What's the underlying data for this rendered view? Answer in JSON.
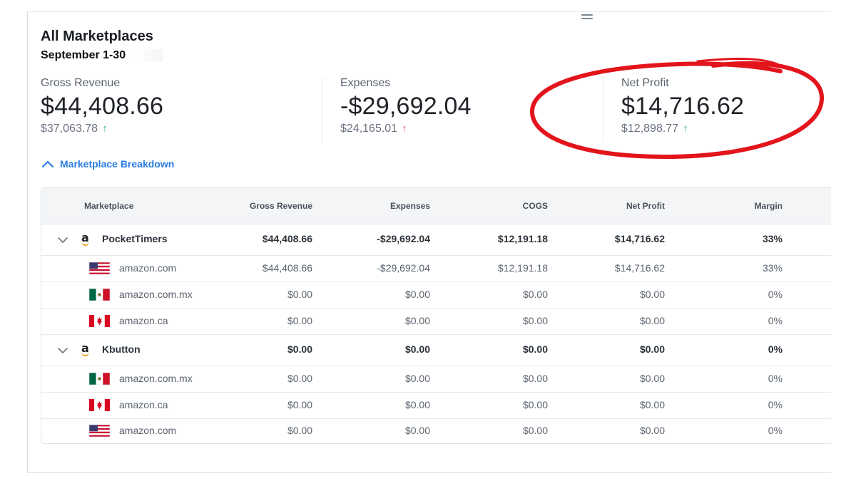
{
  "header": {
    "title": "All Marketplaces",
    "date_range": "September 1-30"
  },
  "summary": {
    "gross_revenue": {
      "label": "Gross Revenue",
      "value": "$44,408.66",
      "previous": "$37,063.78",
      "trend": "up",
      "trend_color": "#2fb67c"
    },
    "expenses": {
      "label": "Expenses",
      "value": "-$29,692.04",
      "previous": "$24,165.01",
      "trend": "up",
      "trend_color": "#e8585a"
    },
    "net_profit": {
      "label": "Net Profit",
      "value": "$14,716.62",
      "previous": "$12,898.77",
      "trend": "up",
      "trend_color": "#2fb67c"
    }
  },
  "breakdown": {
    "toggle_label": "Marketplace Breakdown",
    "expanded": true,
    "columns": [
      "Marketplace",
      "Gross Revenue",
      "Expenses",
      "COGS",
      "Net Profit",
      "Margin"
    ],
    "rows": [
      {
        "type": "group",
        "name": "PocketTimers",
        "icon": "amazon-logo-icon",
        "gross": "$44,408.66",
        "expenses": "-$29,692.04",
        "cogs": "$12,191.18",
        "net": "$14,716.62",
        "margin": "33%"
      },
      {
        "type": "child",
        "name": "amazon.com",
        "flag": "us-flag-icon",
        "gross": "$44,408.66",
        "expenses": "-$29,692.04",
        "cogs": "$12,191.18",
        "net": "$14,716.62",
        "margin": "33%"
      },
      {
        "type": "child",
        "name": "amazon.com.mx",
        "flag": "mx-flag-icon",
        "gross": "$0.00",
        "expenses": "$0.00",
        "cogs": "$0.00",
        "net": "$0.00",
        "margin": "0%"
      },
      {
        "type": "child",
        "name": "amazon.ca",
        "flag": "ca-flag-icon",
        "gross": "$0.00",
        "expenses": "$0.00",
        "cogs": "$0.00",
        "net": "$0.00",
        "margin": "0%"
      },
      {
        "type": "group",
        "name": "Kbutton",
        "icon": "amazon-logo-icon",
        "gross": "$0.00",
        "expenses": "$0.00",
        "cogs": "$0.00",
        "net": "$0.00",
        "margin": "0%"
      },
      {
        "type": "child",
        "name": "amazon.com.mx",
        "flag": "mx-flag-icon",
        "gross": "$0.00",
        "expenses": "$0.00",
        "cogs": "$0.00",
        "net": "$0.00",
        "margin": "0%"
      },
      {
        "type": "child",
        "name": "amazon.ca",
        "flag": "ca-flag-icon",
        "gross": "$0.00",
        "expenses": "$0.00",
        "cogs": "$0.00",
        "net": "$0.00",
        "margin": "0%"
      },
      {
        "type": "child",
        "name": "amazon.com",
        "flag": "us-flag-icon",
        "gross": "$0.00",
        "expenses": "$0.00",
        "cogs": "$0.00",
        "net": "$0.00",
        "margin": "0%"
      }
    ]
  },
  "colors": {
    "accent_link": "#2a7de1",
    "highlight_ring": "#e3141b"
  }
}
